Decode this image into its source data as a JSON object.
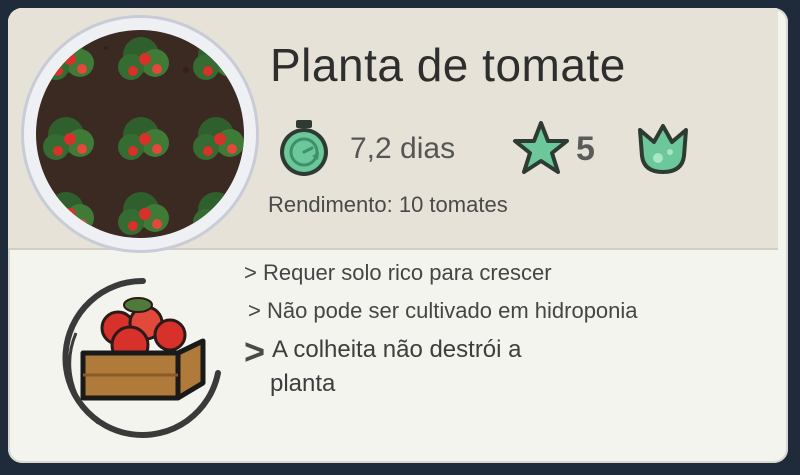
{
  "title": "Planta de tomate",
  "stats": {
    "growth_time": "7,2 dias",
    "growth_time_icon": "stopwatch-icon",
    "rating": "5",
    "rating_icon": "star-icon",
    "type_icon": "plant-leaf-icon"
  },
  "yield": "Rendimento: 10 tomates",
  "notes": [
    "> Requer solo rico para crescer",
    "> Não pode ser cultivado em hidroponia",
    "A colheita não destrói a",
    "planta"
  ],
  "note_marker": ">",
  "colors": {
    "accent_green": "#6cc79a",
    "icon_outline": "#2d3b33",
    "tomato_red": "#d8302a",
    "soil": "#3a2a22"
  }
}
